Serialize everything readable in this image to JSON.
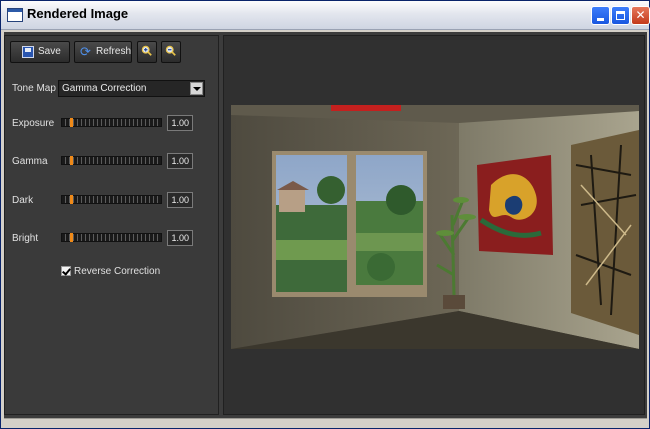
{
  "window": {
    "title": "Rendered Image"
  },
  "toolbar": {
    "save_label": "Save",
    "refresh_label": "Refresh",
    "icons": {
      "save": "floppy-disk-icon",
      "refresh": "refresh-icon",
      "zoom_in": "zoom-in-icon",
      "zoom_out": "zoom-out-icon"
    }
  },
  "tone_map": {
    "label": "Tone Map",
    "selected": "Gamma Correction"
  },
  "sliders": [
    {
      "label": "Exposure",
      "value": "1.00"
    },
    {
      "label": "Gamma",
      "value": "1.00"
    },
    {
      "label": "Dark",
      "value": "1.00"
    },
    {
      "label": "Bright",
      "value": "1.00"
    }
  ],
  "reverse_correction": {
    "label": "Reverse Correction",
    "checked": true
  },
  "colors": {
    "accent": "#f08a18",
    "panel": "#3a3a3a",
    "titlebar_close": "#c3391b"
  }
}
